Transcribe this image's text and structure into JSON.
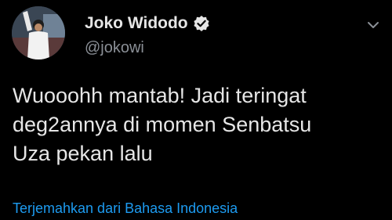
{
  "author": {
    "name": "Joko Widodo",
    "handle": "@jokowi",
    "avatar_icon": "profile-photo",
    "verified_icon": "verified-badge-icon"
  },
  "tweet": {
    "lines": [
      "Wuooohh mantab! Jadi teringat",
      "deg2annya di momen Senbatsu",
      "Uza pekan lalu"
    ]
  },
  "translate_link": "Terjemahkan dari Bahasa Indonesia",
  "menu_icon": "chevron-down-icon",
  "colors": {
    "background": "#000000",
    "text": "#e6e6e6",
    "secondary_text": "#8a8f96",
    "link": "#1d9bf0"
  }
}
